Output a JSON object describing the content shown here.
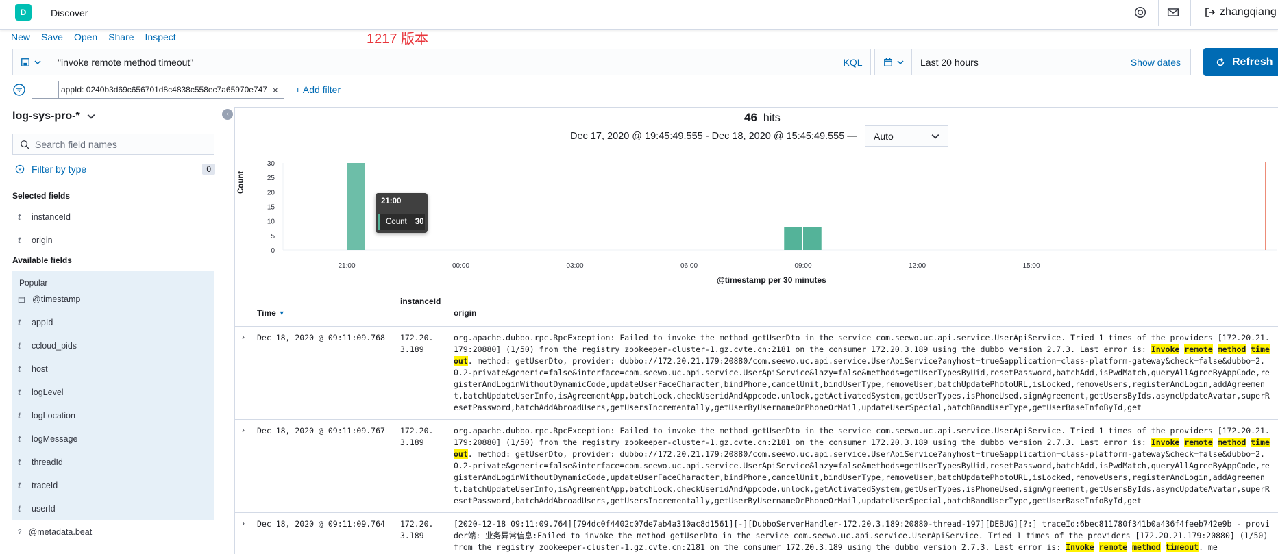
{
  "topbar": {
    "logo": "D",
    "breadcrumb": "Discover",
    "username": "zhangqiang"
  },
  "menu": {
    "new": "New",
    "save": "Save",
    "open": "Open",
    "share": "Share",
    "inspect": "Inspect"
  },
  "annotation": "1217 版本",
  "query": {
    "text": "\"invoke remote method timeout\"",
    "language": "KQL"
  },
  "date": {
    "range": "Last 20 hours",
    "show_dates": "Show dates"
  },
  "refresh": "Refresh",
  "filter": {
    "pill": "appId: 0240b3d69c656701d8c4838c558ec7a65970e747",
    "add": "+ Add filter"
  },
  "sidebar": {
    "index": "log-sys-pro-*",
    "search_placeholder": "Search field names",
    "filter_by_type": "Filter by type",
    "filter_count": "0",
    "selected_title": "Selected fields",
    "selected": [
      "instanceId",
      "origin"
    ],
    "available_title": "Available fields",
    "popular_title": "Popular",
    "popular": [
      "@timestamp",
      "appId",
      "ccloud_pids",
      "host",
      "logLevel",
      "logLocation",
      "logMessage",
      "threadId",
      "traceId",
      "userId"
    ],
    "other": [
      "@metadata.beat"
    ]
  },
  "hits": {
    "count": "46",
    "label": "hits"
  },
  "range_text": "Dec 17, 2020 @ 19:45:49.555 - Dec 18, 2020 @ 15:45:49.555 —",
  "interval": "Auto",
  "chart_data": {
    "type": "bar",
    "ylabel": "Count",
    "xlabel": "@timestamp per 30 minutes",
    "y_ticks": [
      0,
      5,
      10,
      15,
      20,
      25,
      30
    ],
    "ylim": [
      0,
      30
    ],
    "x_ticks": [
      "21:00",
      "00:00",
      "03:00",
      "06:00",
      "09:00",
      "12:00",
      "15:00"
    ],
    "bars": [
      {
        "x": "21:00",
        "value": 30
      },
      {
        "x": "08:30",
        "value": 8
      },
      {
        "x": "09:00",
        "value": 8
      }
    ],
    "color": "#54b399"
  },
  "tooltip": {
    "title": "21:00",
    "label": "Count",
    "value": "30"
  },
  "table": {
    "headers": {
      "time": "Time",
      "instance": "instanceId",
      "origin": "origin"
    },
    "rows": [
      {
        "time": "Dec 18, 2020 @ 09:11:09.768",
        "instance": "172.20.3.189",
        "pre": "org.apache.dubbo.rpc.RpcException: Failed to invoke the method getUserDto in the service com.seewo.uc.api.service.UserApiService. Tried 1 times of the providers [172.20.21.179:20880] (1/50) from the registry zookeeper-cluster-1.gz.cvte.cn:2181 on the consumer 172.20.3.189 using the dubbo version 2.7.3. Last error is: ",
        "h1": "Invoke",
        "h2": "remote",
        "h3": "method",
        "h4": "timeout",
        "post": ". method: getUserDto, provider: dubbo://172.20.21.179:20880/com.seewo.uc.api.service.UserApiService?anyhost=true&application=class-platform-gateway&check=false&dubbo=2.0.2-private&generic=false&interface=com.seewo.uc.api.service.UserApiService&lazy=false&methods=getUserTypesByUid,resetPassword,batchAdd,isPwdMatch,queryAllAgreeByAppCode,registerAndLoginWithoutDynamicCode,updateUserFaceCharacter,bindPhone,cancelUnit,bindUserType,removeUser,batchUpdatePhotoURL,isLocked,removeUsers,registerAndLogin,addAgreement,batchUpdateUserInfo,isAgreementApp,batchLock,checkUseridAndAppcode,unlock,getActivatedSystem,getUserTypes,isPhoneUsed,signAgreement,getUsersByIds,asyncUpdateAvatar,superResetPassword,batchAddAbroadUsers,getUsersIncrementally,getUserByUsernameOrPhoneOrMail,updateUserSpecial,batchBandUserType,getUserBaseInfoById,get"
      },
      {
        "time": "Dec 18, 2020 @ 09:11:09.767",
        "instance": "172.20.3.189",
        "pre": "org.apache.dubbo.rpc.RpcException: Failed to invoke the method getUserDto in the service com.seewo.uc.api.service.UserApiService. Tried 1 times of the providers [172.20.21.179:20880] (1/50) from the registry zookeeper-cluster-1.gz.cvte.cn:2181 on the consumer 172.20.3.189 using the dubbo version 2.7.3. Last error is: ",
        "h1": "Invoke",
        "h2": "remote",
        "h3": "method",
        "h4": "timeout",
        "post": ". method: getUserDto, provider: dubbo://172.20.21.179:20880/com.seewo.uc.api.service.UserApiService?anyhost=true&application=class-platform-gateway&check=false&dubbo=2.0.2-private&generic=false&interface=com.seewo.uc.api.service.UserApiService&lazy=false&methods=getUserTypesByUid,resetPassword,batchAdd,isPwdMatch,queryAllAgreeByAppCode,registerAndLoginWithoutDynamicCode,updateUserFaceCharacter,bindPhone,cancelUnit,bindUserType,removeUser,batchUpdatePhotoURL,isLocked,removeUsers,registerAndLogin,addAgreement,batchUpdateUserInfo,isAgreementApp,batchLock,checkUseridAndAppcode,unlock,getActivatedSystem,getUserTypes,isPhoneUsed,signAgreement,getUsersByIds,asyncUpdateAvatar,superResetPassword,batchAddAbroadUsers,getUsersIncrementally,getUserByUsernameOrPhoneOrMail,updateUserSpecial,batchBandUserType,getUserBaseInfoById,get"
      },
      {
        "time": "Dec 18, 2020 @ 09:11:09.764",
        "instance": "172.20.3.189",
        "pre": "[2020-12-18 09:11:09.764][794dc0f4402c07de7ab4a310ac8d1561][-][DubboServerHandler-172.20.3.189:20880-thread-197][DEBUG][?:] traceId:6bec811780f341b0a436f4feeb742e9b - provider端: 业务异常信息:Failed to invoke the method getUserDto in the service com.seewo.uc.api.service.UserApiService. Tried 1 times of the providers [172.20.21.179:20880] (1/50) from the registry zookeeper-cluster-1.gz.cvte.cn:2181 on the consumer 172.20.3.189 using the dubbo version 2.7.3. Last error is: ",
        "h1": "Invoke",
        "h2": "remote",
        "h3": "method",
        "h4": "timeout",
        "post": ". me"
      }
    ]
  }
}
